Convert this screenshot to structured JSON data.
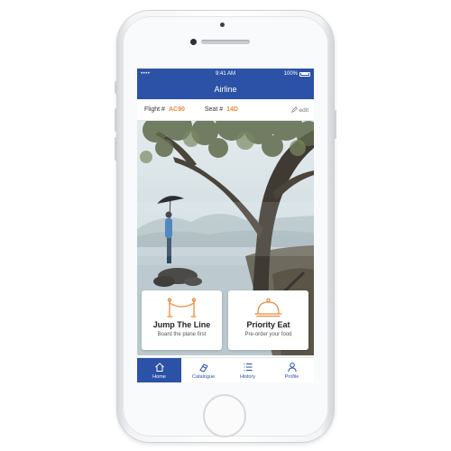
{
  "status_bar": {
    "signal": "•••• ",
    "time": "9:41 AM",
    "battery": "100%"
  },
  "nav": {
    "title": "Airline"
  },
  "info_bar": {
    "flight_label": "Flight #",
    "flight_value": "AC90",
    "seat_label": "Seat #",
    "seat_value": "14D",
    "edit_label": "edit"
  },
  "cards": [
    {
      "title": "Jump The Line",
      "subtitle": "Board the plane first",
      "icon": "gate-icon"
    },
    {
      "title": "Priority Eat",
      "subtitle": "Pre-order your food",
      "icon": "cloche-icon"
    }
  ],
  "tabs": [
    {
      "label": "Home",
      "icon": "home-icon",
      "active": true
    },
    {
      "label": "Catalogue",
      "icon": "catalogue-icon",
      "active": false
    },
    {
      "label": "History",
      "icon": "list-icon",
      "active": false
    },
    {
      "label": "Profile",
      "icon": "user-icon",
      "active": false
    }
  ],
  "colors": {
    "brand_blue": "#2b52a6",
    "accent_orange": "#f08a3a"
  }
}
